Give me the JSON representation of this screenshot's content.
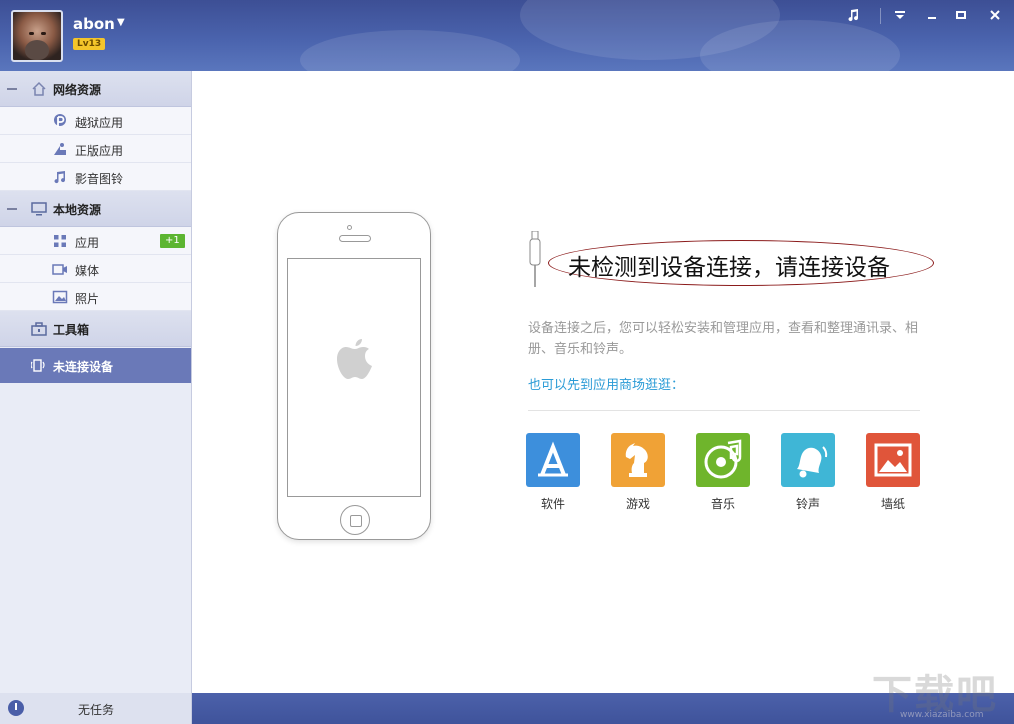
{
  "user": {
    "name": "abon",
    "level": "Lv13"
  },
  "titlebar": {
    "music_icon": "music-note-icon",
    "menu_icon": "dropdown-menu-icon",
    "minimize_icon": "minimize-icon",
    "maximize_icon": "maximize-icon",
    "close_icon": "close-icon"
  },
  "sidebar": {
    "network_resources": {
      "label": "网络资源",
      "items": [
        {
          "label": "越狱应用",
          "icon": "pp-icon"
        },
        {
          "label": "正版应用",
          "icon": "app-store-icon"
        },
        {
          "label": "影音图铃",
          "icon": "music-note-icon"
        }
      ]
    },
    "local_resources": {
      "label": "本地资源",
      "items": [
        {
          "label": "应用",
          "icon": "grid-icon",
          "badge": "+1"
        },
        {
          "label": "媒体",
          "icon": "video-icon"
        },
        {
          "label": "照片",
          "icon": "photo-icon"
        }
      ]
    },
    "toolbox": {
      "label": "工具箱"
    },
    "device": {
      "label": "未连接设备"
    }
  },
  "status": {
    "text": "无任务"
  },
  "main": {
    "headline": "未检测到设备连接，请连接设备",
    "description": "设备连接之后，您可以轻松安装和管理应用，查看和整理通讯录、相册、音乐和铃声。",
    "store_link": "也可以先到应用商场逛逛：",
    "apps": [
      {
        "label": "软件",
        "icon": "app-store-a-icon",
        "color": "#3d8fdc"
      },
      {
        "label": "游戏",
        "icon": "chess-knight-icon",
        "color": "#f0a236"
      },
      {
        "label": "音乐",
        "icon": "music-disc-icon",
        "color": "#6fb52c"
      },
      {
        "label": "铃声",
        "icon": "bell-icon",
        "color": "#3fb6d6"
      },
      {
        "label": "墙纸",
        "icon": "wallpaper-icon",
        "color": "#e0553a"
      }
    ]
  },
  "watermark": {
    "text": "下载吧",
    "sub": "www.xiazaiba.com"
  }
}
